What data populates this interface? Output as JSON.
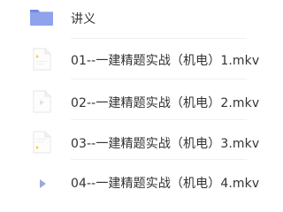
{
  "files": [
    {
      "name": "讲义",
      "type": "folder",
      "icon": "folder-icon"
    },
    {
      "name": "01--一建精题实战（机电）1.mkv",
      "type": "video",
      "icon": "video-file-icon"
    },
    {
      "name": "02--一建精题实战（机电）2.mkv",
      "type": "video",
      "icon": "video-file-icon"
    },
    {
      "name": "03--一建精题实战（机电）3.mkv",
      "type": "video",
      "icon": "video-file-icon"
    },
    {
      "name": "04--一建精题实战（机电）4.mkv",
      "type": "video",
      "icon": "play-icon"
    }
  ],
  "colors": {
    "folder": "#8ea3ec",
    "folder_dark": "#7389e2",
    "file_border": "#e6e6e6",
    "file_accent": "#f5c542",
    "play": "#9aa9d8",
    "separator": "#f0f0f0"
  }
}
